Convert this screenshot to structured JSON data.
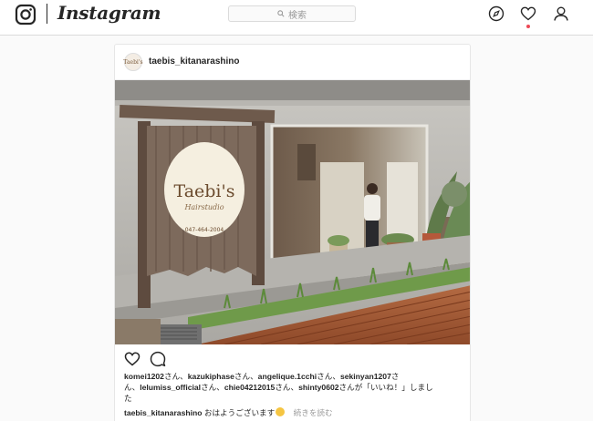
{
  "app": {
    "wordmark": "Instagram",
    "search_placeholder": "検索"
  },
  "nav_icons": [
    "instagram-camera-icon",
    "explore-compass-icon",
    "activity-heart-icon",
    "profile-person-icon"
  ],
  "post": {
    "username": "taebis_kitanarashino",
    "avatar_text": "Taebi's",
    "photo": {
      "sign_title": "Taebi's",
      "sign_subtitle": "Hairstudio",
      "sign_phone": "047-464-2004"
    },
    "likes": {
      "users": [
        "komei1202",
        "kazukiphase",
        "angelique.1cchi",
        "sekinyan1207",
        "lelumiss_official",
        "chie04212015",
        "shinty0602"
      ],
      "line1_users": [
        {
          "name": "komei1202",
          "sep": "さん、"
        },
        {
          "name": "kazukiphase",
          "sep": "さん、"
        },
        {
          "name": "angelique.1cchi",
          "sep": "さん、"
        },
        {
          "name": "sekinyan1207",
          "sep": "さ"
        }
      ],
      "line2_prefix": "ん、",
      "line2_users": [
        {
          "name": "lelumiss_official",
          "sep": "さん、"
        },
        {
          "name": "chie04212015",
          "sep": "さん、"
        },
        {
          "name": "shinty0602",
          "sep": "さんが「いいね！」しまし"
        }
      ],
      "line3": "た"
    },
    "caption": {
      "user": "taebis_kitanarashino",
      "text": "おはようございます",
      "more": "続きを読む"
    }
  },
  "colors": {
    "accent_red": "#ed4956",
    "border": "#dbdbdb",
    "text": "#262626",
    "muted": "#999999"
  }
}
